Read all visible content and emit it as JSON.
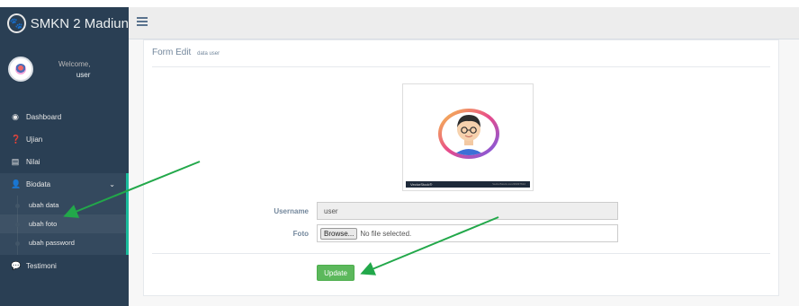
{
  "brand": {
    "title": "SMKN 2 Madiun",
    "icon": "paw-icon"
  },
  "profile": {
    "welcome": "Welcome,",
    "username": "user"
  },
  "menu": {
    "items": [
      {
        "label": "Dashboard",
        "icon": "dashboard-icon"
      },
      {
        "label": "Ujian",
        "icon": "question-circle-icon"
      },
      {
        "label": "Nilai",
        "icon": "table-icon"
      }
    ],
    "group": {
      "label": "Biodata",
      "icon": "user-icon",
      "sub": [
        {
          "label": "ubah data"
        },
        {
          "label": "ubah foto"
        },
        {
          "label": "ubah password"
        }
      ]
    },
    "after": [
      {
        "label": "Testimoni",
        "icon": "comment-icon"
      }
    ]
  },
  "panel": {
    "title": "Form Edit",
    "subtitle": "data user"
  },
  "form": {
    "username_label": "Username",
    "username_value": "user",
    "foto_label": "Foto",
    "browse_label": "Browse...",
    "file_status": "No file selected.",
    "update_label": "Update"
  },
  "photo": {
    "caption_left": "VectorStock®",
    "caption_right": "VectorStock.com/29037612"
  },
  "colors": {
    "sidebar": "#2a3f54",
    "accent": "#1abb9c",
    "button": "#5cb85c",
    "arrow": "#22a84a"
  }
}
